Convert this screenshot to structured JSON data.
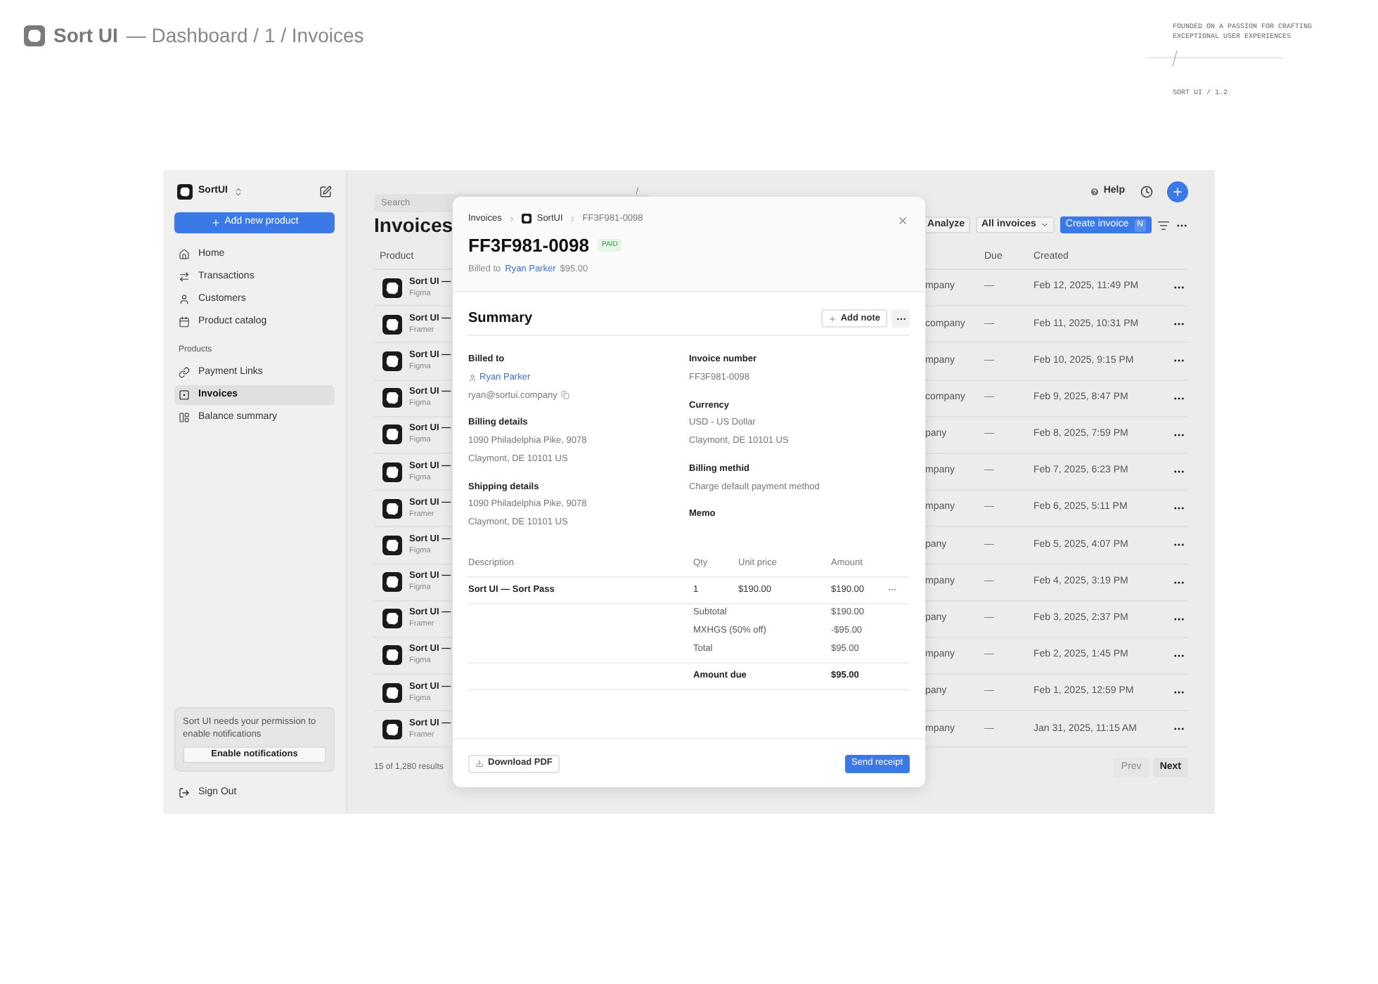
{
  "header": {
    "brand": "Sort UI",
    "path": "— Dashboard / 1 / Invoices",
    "tagline": [
      "FOUNDED ON A PASSION FOR CRAFTING",
      "EXCEPTIONAL USER EXPERIENCES"
    ],
    "version": "SORT UI / 1.2"
  },
  "sidebar": {
    "workspace": "SortUI",
    "add_button": "Add new product",
    "items": [
      {
        "label": "Home",
        "selected": false
      },
      {
        "label": "Transactions",
        "selected": false
      },
      {
        "label": "Customers",
        "selected": false
      },
      {
        "label": "Product catalog",
        "selected": false
      }
    ],
    "section": "Products",
    "section_items": [
      {
        "label": "Payment Links",
        "selected": false
      },
      {
        "label": "Invoices",
        "selected": true
      },
      {
        "label": "Balance summary",
        "selected": false
      }
    ],
    "notice": {
      "text": "Sort UI needs your permission to enable notifications",
      "button": "Enable notifications"
    },
    "sign_out": "Sign Out"
  },
  "topbar": {
    "search_placeholder": "Search",
    "search_shortcut": "/",
    "help": "Help"
  },
  "page": {
    "title": "Invoices",
    "toolbar": {
      "analyze": "Analyze",
      "filter": "All invoices",
      "create": "Create invoice",
      "create_shortcut": "N"
    },
    "table": {
      "columns": [
        "Product",
        "Due",
        "Created"
      ],
      "rows": [
        {
          "product": "Sort UI —",
          "platform": "Figma",
          "customer": "mpany",
          "due": "—",
          "created": "Feb 12, 2025, 11:49 PM"
        },
        {
          "product": "Sort UI —",
          "platform": "Framer",
          "customer": "company",
          "due": "—",
          "created": "Feb 11, 2025, 10:31 PM"
        },
        {
          "product": "Sort UI —",
          "platform": "Figma",
          "customer": "mpany",
          "due": "—",
          "created": "Feb 10, 2025, 9:15 PM"
        },
        {
          "product": "Sort UI —",
          "platform": "Figma",
          "customer": "company",
          "due": "—",
          "created": "Feb 9, 2025, 8:47 PM"
        },
        {
          "product": "Sort UI —",
          "platform": "Figma",
          "customer": "pany",
          "due": "—",
          "created": "Feb 8, 2025, 7:59 PM"
        },
        {
          "product": "Sort UI —",
          "platform": "Figma",
          "customer": "mpany",
          "due": "—",
          "created": "Feb 7, 2025, 6:23 PM"
        },
        {
          "product": "Sort UI —",
          "platform": "Framer",
          "customer": "mpany",
          "due": "—",
          "created": "Feb 6, 2025, 5:11 PM"
        },
        {
          "product": "Sort UI —",
          "platform": "Figma",
          "customer": "pany",
          "due": "—",
          "created": "Feb 5, 2025, 4:07 PM"
        },
        {
          "product": "Sort UI —",
          "platform": "Figma",
          "customer": "mpany",
          "due": "—",
          "created": "Feb 4, 2025, 3:19 PM"
        },
        {
          "product": "Sort UI —",
          "platform": "Framer",
          "customer": "pany",
          "due": "—",
          "created": "Feb 3, 2025, 2:37 PM"
        },
        {
          "product": "Sort UI —",
          "platform": "Figma",
          "customer": "mpany",
          "due": "—",
          "created": "Feb 2, 2025, 1:45 PM"
        },
        {
          "product": "Sort UI —",
          "platform": "Figma",
          "customer": "pany",
          "due": "—",
          "created": "Feb 1, 2025, 12:59 PM"
        },
        {
          "product": "Sort UI —",
          "platform": "Framer",
          "customer": "mpany",
          "due": "—",
          "created": "Jan 31, 2025, 11:15 AM"
        }
      ]
    },
    "footer": {
      "count": "15 of 1,280 results",
      "prev": "Prev",
      "prev_disabled": true,
      "next": "Next"
    }
  },
  "modal": {
    "breadcrumb": [
      "Invoices",
      "SortUI",
      "FF3F981-0098"
    ],
    "title": "FF3F981-0098",
    "status": "PAID",
    "billed_prefix": "Billed to",
    "billed_name": "Ryan Parker",
    "billed_amount": "$95.00",
    "summary_title": "Summary",
    "add_note": "Add note",
    "left": [
      {
        "label": "Billed to",
        "kind": "contact",
        "name": "Ryan Parker",
        "email": "ryan@sortui.company"
      },
      {
        "label": "Billing details",
        "kind": "lines",
        "lines": [
          "1090 Philadelphia Pike, 9078",
          "Claymont, DE 10101 US"
        ]
      },
      {
        "label": "Shipping details",
        "kind": "lines",
        "lines": [
          "1090 Philadelphia Pike, 9078",
          "Claymont, DE 10101 US"
        ]
      }
    ],
    "right": [
      {
        "label": "Invoice number",
        "kind": "lines",
        "lines": [
          "FF3F981-0098"
        ]
      },
      {
        "label": "Currency",
        "kind": "lines",
        "lines": [
          "USD - US Dollar",
          "Claymont, DE 10101 US"
        ]
      },
      {
        "label": "Billing methid",
        "kind": "lines",
        "lines": [
          "Charge default payment method"
        ]
      },
      {
        "label": "Memo",
        "kind": "lines"
      }
    ],
    "items": {
      "columns": [
        "Description",
        "Qty",
        "Unit price",
        "Amount"
      ],
      "rows": [
        {
          "description": "Sort UI — Sort Pass",
          "qty": "1",
          "unit_price": "$190.00",
          "amount": "$190.00"
        }
      ],
      "totals": [
        {
          "label": "Subtotal",
          "value": "$190.00"
        },
        {
          "label": "MXHGS (50% off)",
          "value": "-$95.00"
        },
        {
          "label": "Total",
          "value": "$95.00"
        }
      ],
      "due_label": "Amount due",
      "due_value": "$95.00"
    },
    "download": "Download PDF",
    "send": "Send receipt"
  }
}
